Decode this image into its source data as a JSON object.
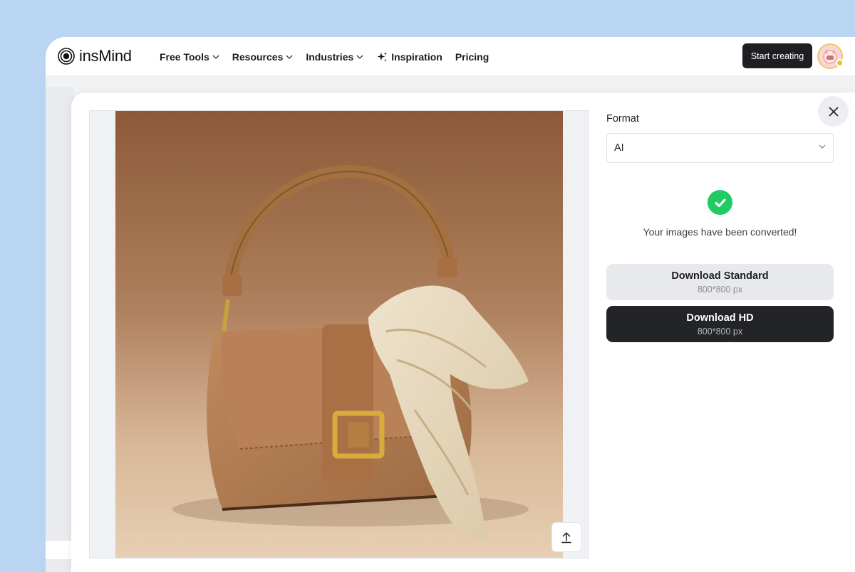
{
  "brand": {
    "name": "insMind"
  },
  "nav": {
    "items": [
      {
        "label": "Free Tools",
        "has_dropdown": true
      },
      {
        "label": "Resources",
        "has_dropdown": true
      },
      {
        "label": "Industries",
        "has_dropdown": true
      },
      {
        "label": "Inspiration",
        "has_dropdown": false,
        "icon": "sparkle-icon"
      },
      {
        "label": "Pricing",
        "has_dropdown": false
      }
    ],
    "cta_label": "Start creating"
  },
  "modal": {
    "format_label": "Format",
    "format_value": "AI",
    "success_message": "Your images have been converted!",
    "download_standard": {
      "title": "Download Standard",
      "size": "800*800 px"
    },
    "download_hd": {
      "title": "Download HD",
      "size": "800*800 px"
    }
  },
  "colors": {
    "background": "#b9d5f1",
    "cta_dark": "#1e1f22",
    "success_green": "#1fcb63",
    "photo_backdrop": "#a8714a"
  }
}
